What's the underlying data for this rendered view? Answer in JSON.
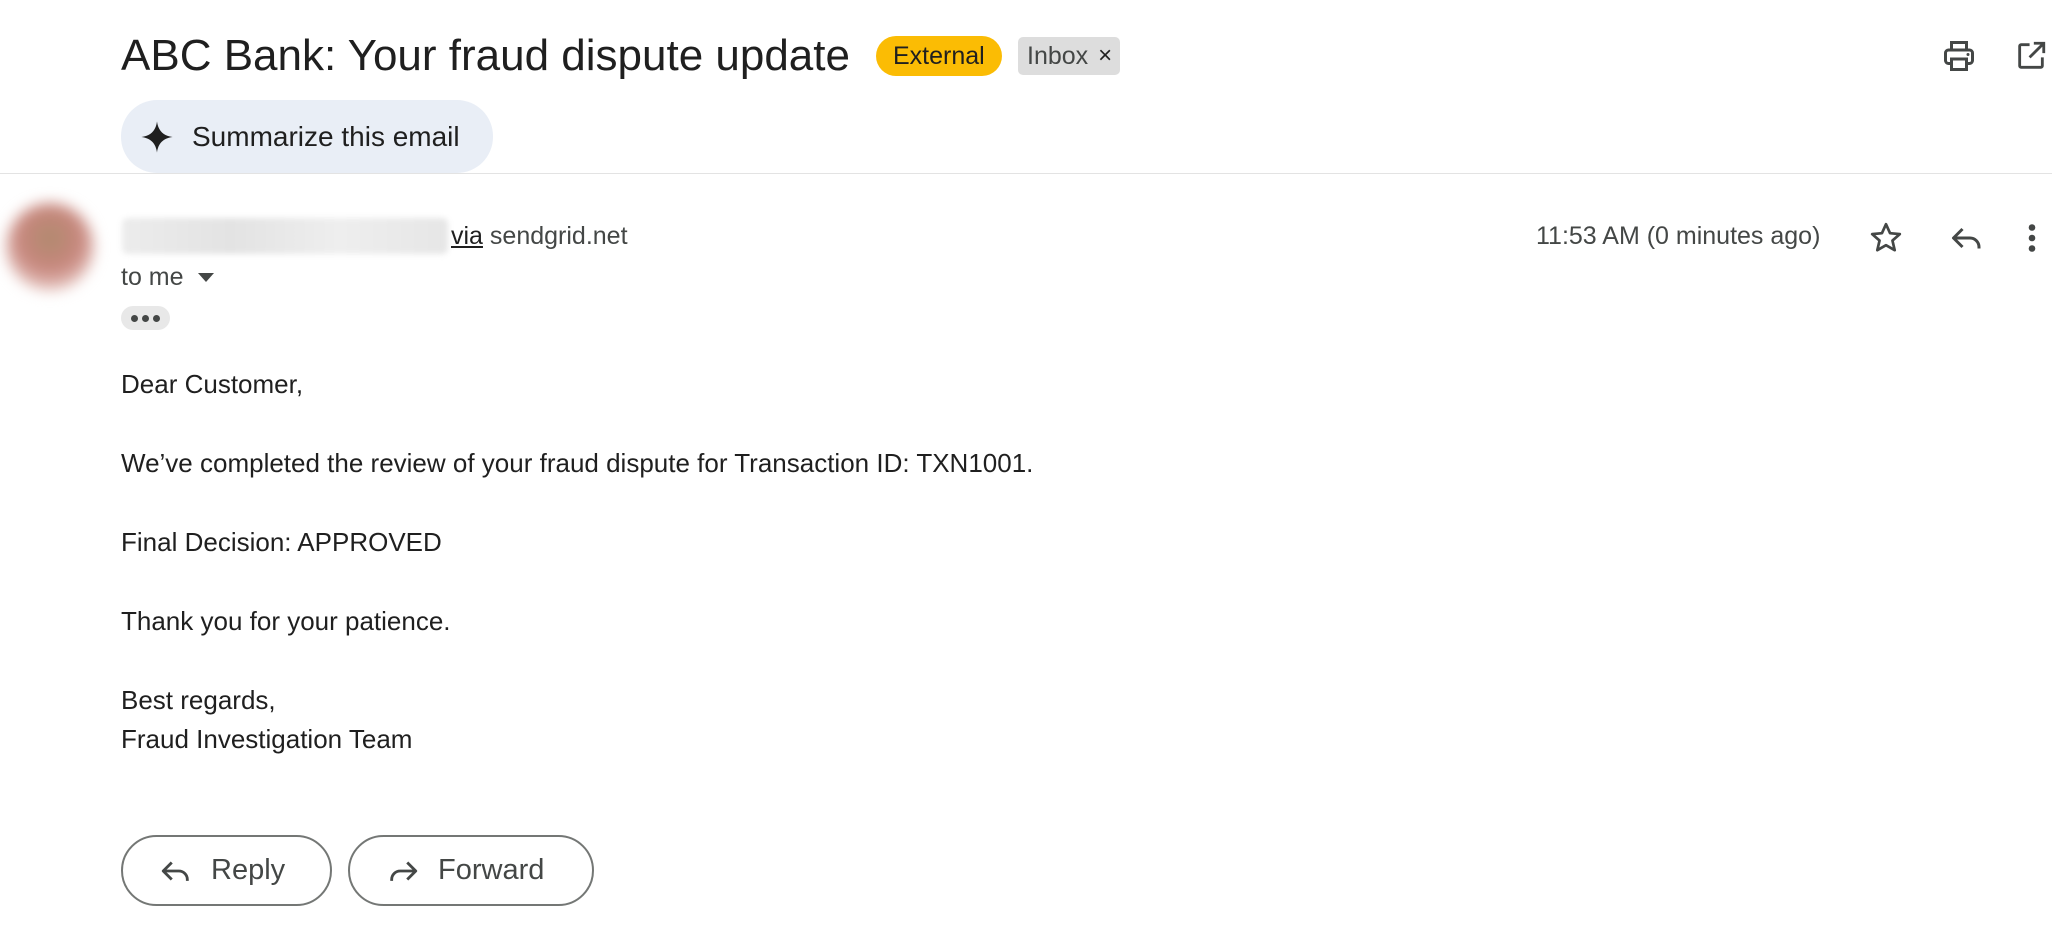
{
  "email": {
    "subject": "ABC Bank: Your fraud dispute update",
    "labels": {
      "external": "External",
      "inbox": "Inbox",
      "remove_symbol": "×"
    },
    "summarize_label": "Summarize this email",
    "sender": {
      "via_word": "via",
      "via_domain": "sendgrid.net"
    },
    "recipient": "to me",
    "timestamp": "11:53 AM (0 minutes ago)",
    "body": {
      "greeting": "Dear Customer,",
      "line1": "We’ve completed the review of your fraud dispute for Transaction ID: TXN1001.",
      "line2": "Final Decision: APPROVED",
      "line3": "Thank you for your patience.",
      "signoff": "Best regards,",
      "signature": "Fraud Investigation Team"
    },
    "actions": {
      "reply": "Reply",
      "forward": "Forward"
    }
  },
  "icons": {
    "toolbar": [
      "print-icon",
      "open-in-new-window-icon"
    ],
    "message": [
      "star-icon",
      "reply-icon",
      "more-vert-icon"
    ],
    "summarize": "sparkle-icon"
  },
  "colors": {
    "external_chip": "#fbbc04",
    "inbox_chip": "#dddddd",
    "summarize_bg": "#e9eef6",
    "text_primary": "#1f1f1f",
    "text_secondary": "#444746"
  }
}
